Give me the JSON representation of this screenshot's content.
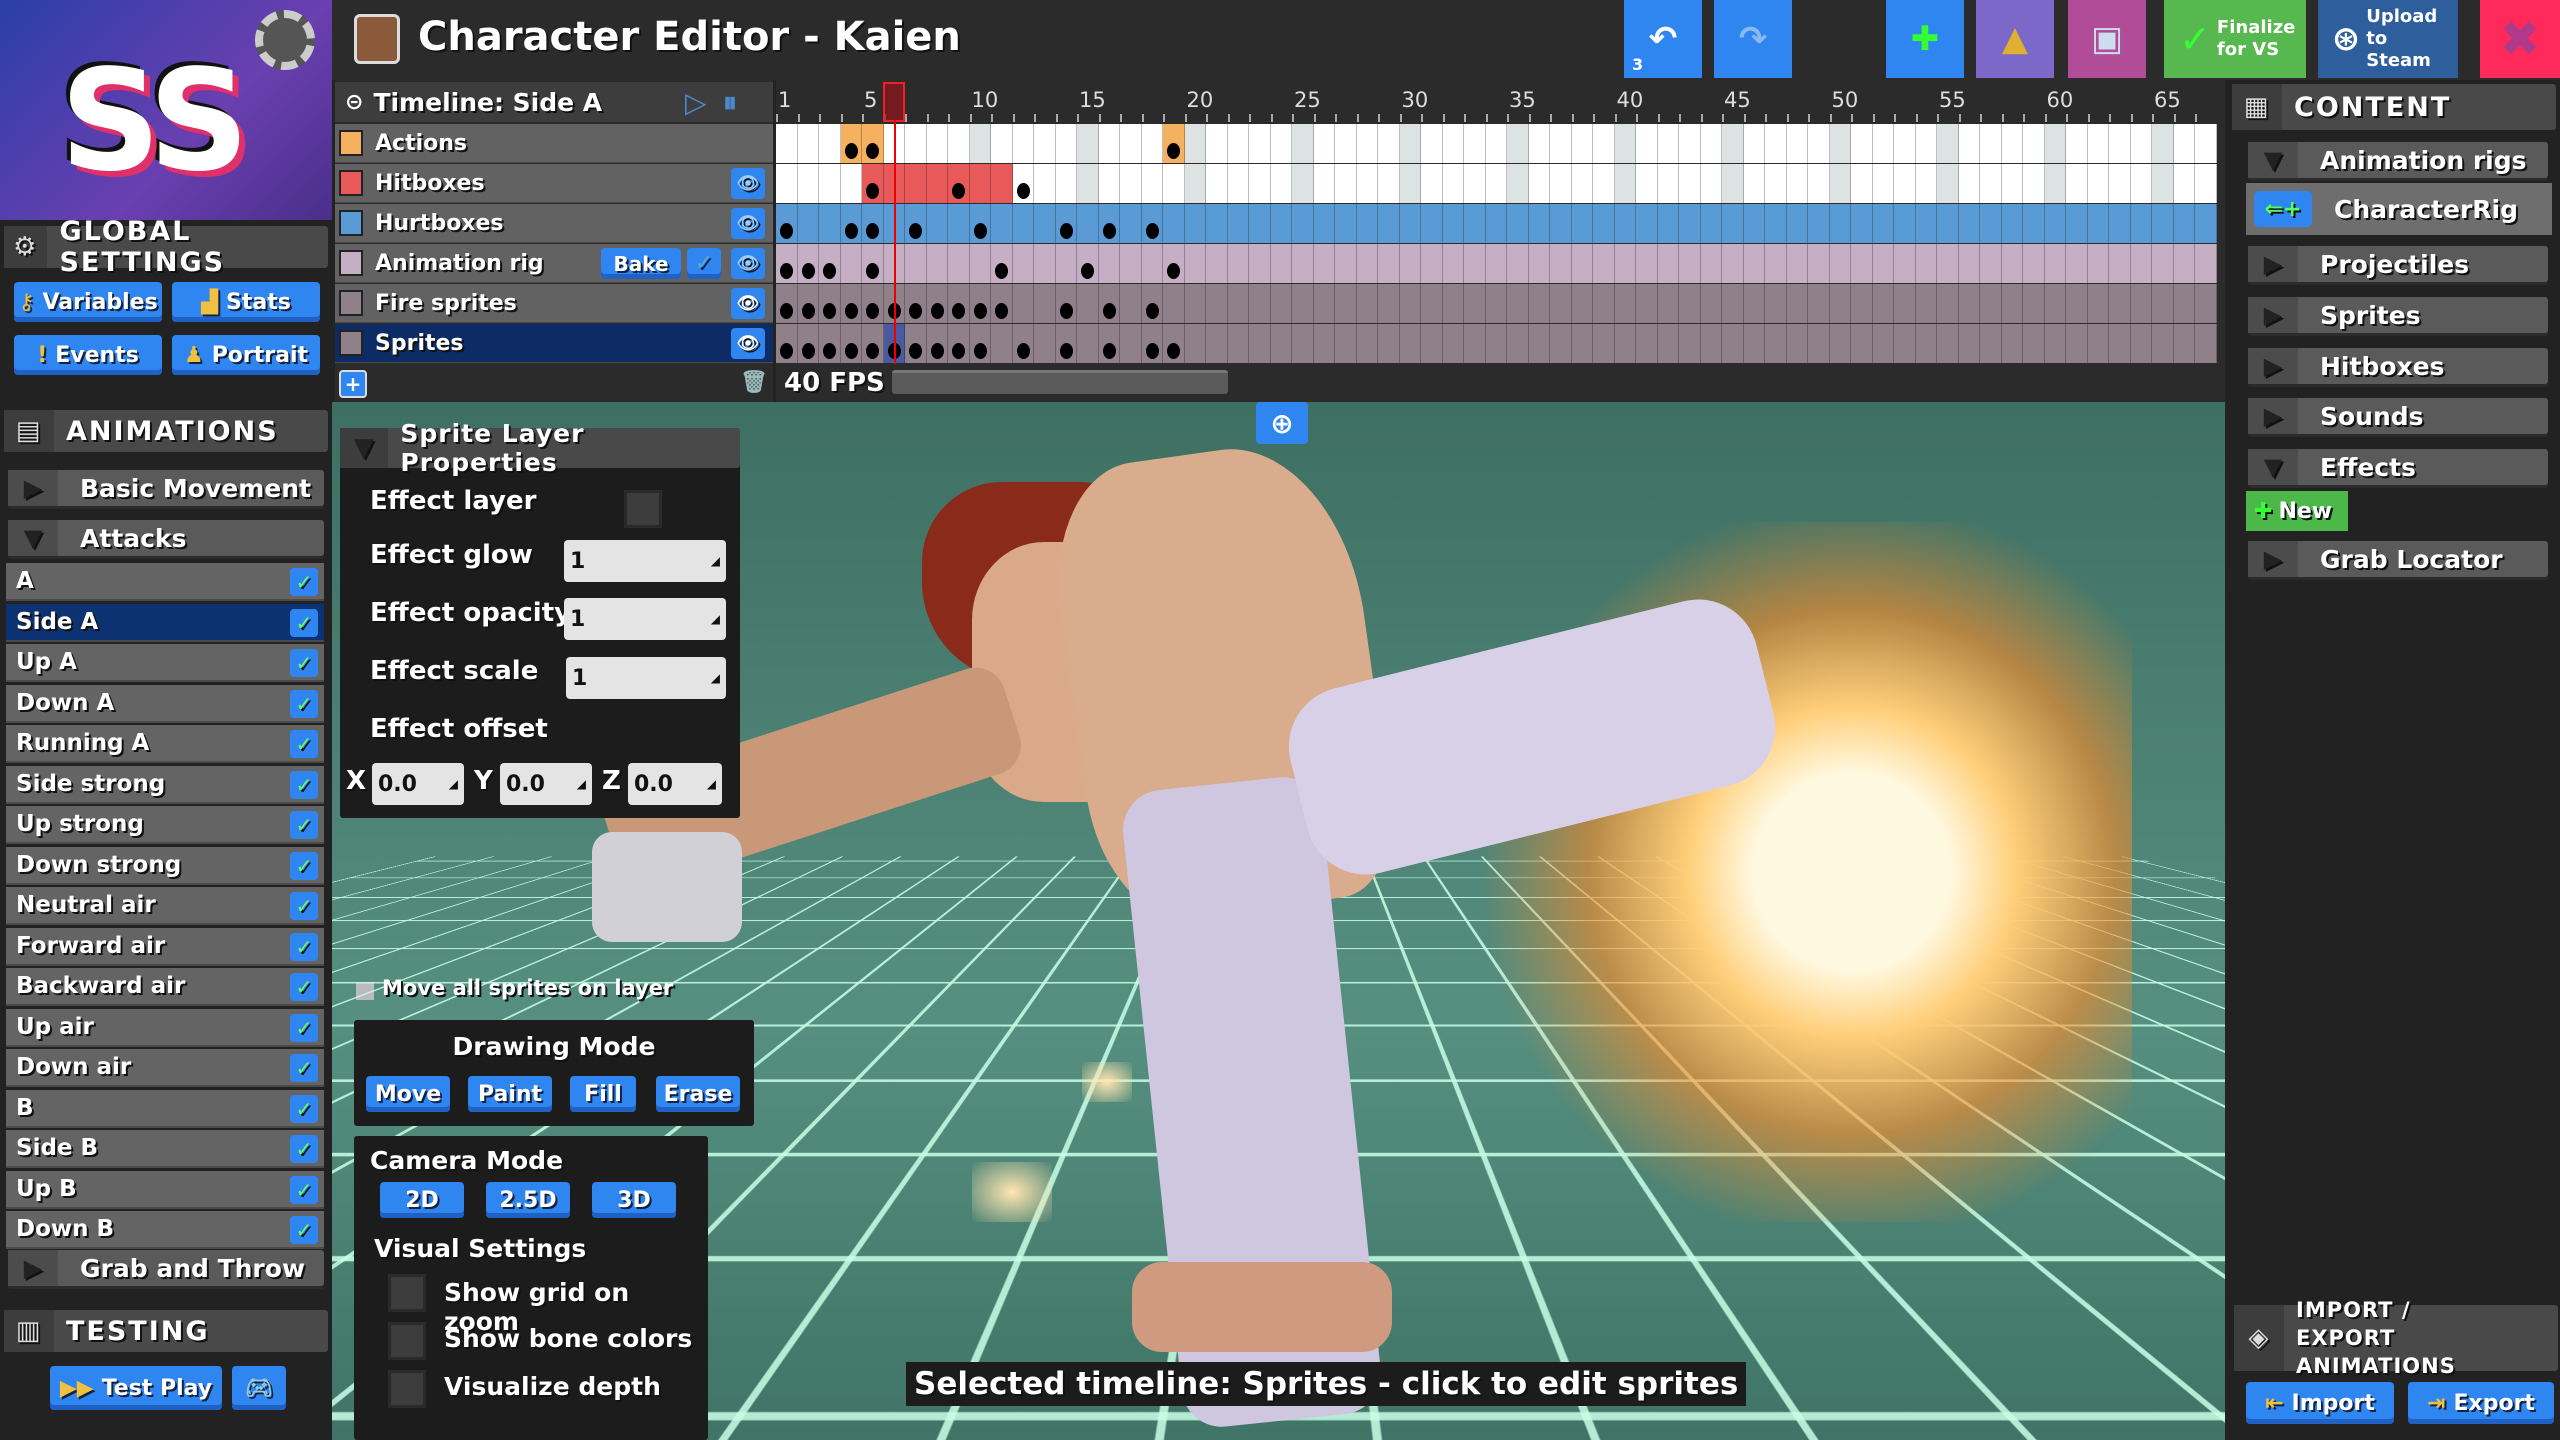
{
  "app": {
    "title": "Character Editor - Kaien",
    "logo_text": "SS"
  },
  "toolbar": {
    "undo_count": "3",
    "finalize_label": "Finalize for VS",
    "upload_label": "Upload to Steam",
    "colors": {
      "blue": "#2f86f0",
      "purple": "#7b68c8",
      "magenta": "#b04c98",
      "green": "#56b84f",
      "steam": "#2e5f9c",
      "close": "#ff2a5a"
    }
  },
  "global_settings": {
    "title": "GLOBAL SETTINGS",
    "buttons": [
      {
        "label": "Variables",
        "icon": "key-icon"
      },
      {
        "label": "Stats",
        "icon": "bar-chart-icon"
      },
      {
        "label": "Events",
        "icon": "exclamation-icon"
      },
      {
        "label": "Portrait",
        "icon": "bust-icon"
      }
    ]
  },
  "animations": {
    "title": "ANIMATIONS",
    "groups": [
      "Basic Movement",
      "Attacks",
      "Grab and Throw"
    ],
    "items": [
      "A",
      "Side A",
      "Up A",
      "Down A",
      "Running A",
      "Side strong",
      "Up strong",
      "Down strong",
      "Neutral air",
      "Forward air",
      "Backward air",
      "Up air",
      "Down air",
      "B",
      "Side B",
      "Up B",
      "Down B"
    ],
    "selected": "Side A"
  },
  "testing": {
    "title": "TESTING",
    "test_play": "Test Play"
  },
  "timeline": {
    "title": "Timeline: Side A",
    "fps": "40 FPS",
    "frame_count": 67,
    "current_frame": 6,
    "ruler_labels": [
      1,
      5,
      10,
      15,
      20,
      25,
      30,
      35,
      40,
      45,
      50,
      55,
      60,
      65
    ],
    "bake_label": "Bake",
    "layers": [
      {
        "name": "Actions",
        "color": "#f5b060",
        "track": "#ffffff",
        "keys": [
          4,
          5,
          19
        ],
        "filled": [
          4,
          5,
          19
        ],
        "eye": false
      },
      {
        "name": "Hitboxes",
        "color": "#e85a5a",
        "track": "#ffffff",
        "keys": [
          5,
          9,
          12
        ],
        "filled": [
          5,
          6,
          7,
          8,
          9,
          10,
          11
        ],
        "eye": true
      },
      {
        "name": "Hurtboxes",
        "color": "#5b9bd5",
        "track": "#5b9bd5",
        "keys": [
          1,
          4,
          5,
          7,
          10,
          14,
          16,
          18
        ],
        "eye": true
      },
      {
        "name": "Animation rig",
        "color": "#c4afc4",
        "track": "#c4afc4",
        "keys": [
          1,
          2,
          3,
          5,
          11,
          15,
          19
        ],
        "eye": true
      },
      {
        "name": "Fire sprites",
        "color": "#8f8089",
        "track": "#8f8089",
        "keys": [
          1,
          2,
          3,
          4,
          5,
          6,
          7,
          8,
          9,
          10,
          11,
          14,
          16,
          18
        ],
        "eye": true
      },
      {
        "name": "Sprites",
        "color": "#8f8089",
        "track": "#8f8089",
        "keys": [
          1,
          2,
          3,
          4,
          5,
          6,
          7,
          8,
          9,
          10,
          12,
          14,
          16,
          18,
          19
        ],
        "eye": true,
        "selected": true
      }
    ]
  },
  "sprite_props": {
    "title": "Sprite Layer Properties",
    "effect_layer": "Effect layer",
    "effect_glow": {
      "label": "Effect glow",
      "value": "1"
    },
    "effect_opacity": {
      "label": "Effect opacity",
      "value": "1"
    },
    "effect_scale": {
      "label": "Effect scale",
      "value": "1"
    },
    "effect_offset": {
      "label": "Effect offset",
      "x": "0.0",
      "y": "0.0",
      "z": "0.0",
      "x_label": "X",
      "y_label": "Y",
      "z_label": "Z"
    },
    "move_all": "Move all sprites on layer"
  },
  "drawing_mode": {
    "title": "Drawing Mode",
    "buttons": [
      "Move",
      "Paint",
      "Fill",
      "Erase"
    ]
  },
  "camera_mode": {
    "title": "Camera Mode",
    "buttons": [
      "2D",
      "2.5D",
      "3D"
    ]
  },
  "visual_settings": {
    "title": "Visual Settings",
    "options": [
      "Show grid on zoom",
      "Show bone colors",
      "Visualize depth"
    ]
  },
  "status": "Selected timeline: Sprites - click to edit sprites",
  "content": {
    "title": "CONTENT",
    "items": [
      "Animation rigs",
      "Projectiles",
      "Sprites",
      "Hitboxes",
      "Sounds",
      "Effects",
      "Grab Locator"
    ],
    "rig": "CharacterRig",
    "new_label": "New"
  },
  "import_export": {
    "title": "IMPORT / EXPORT ANIMATIONS",
    "import": "Import",
    "export": "Export"
  }
}
